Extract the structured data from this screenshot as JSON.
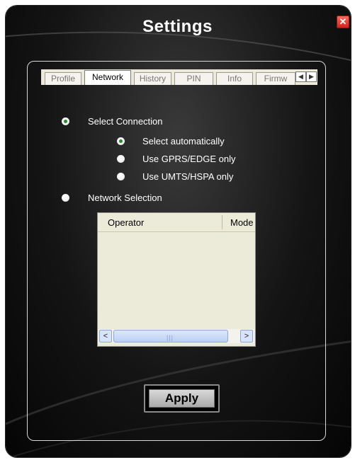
{
  "window": {
    "title": "Settings",
    "close_glyph": "✕"
  },
  "tabs": [
    {
      "label": "Profile",
      "active": false
    },
    {
      "label": "Network",
      "active": true
    },
    {
      "label": "History",
      "active": false
    },
    {
      "label": "PIN",
      "active": false
    },
    {
      "label": "Info",
      "active": false
    },
    {
      "label": "Firmw",
      "active": false
    }
  ],
  "tab_scroll": {
    "left": "◀",
    "right": "▶"
  },
  "connection": {
    "select_connection_label": "Select Connection",
    "select_connection_checked": true,
    "options": [
      {
        "label": "Select automatically",
        "checked": true
      },
      {
        "label": "Use GPRS/EDGE only",
        "checked": false
      },
      {
        "label": "Use UMTS/HSPA only",
        "checked": false
      }
    ],
    "network_selection_label": "Network Selection",
    "network_selection_checked": false
  },
  "operator_list": {
    "columns": [
      "Operator",
      "Mode"
    ],
    "rows": [],
    "scroll_left": "<",
    "scroll_right": ">",
    "scroll_grip": "|||"
  },
  "apply_label": "Apply",
  "colors": {
    "radio_check": "#2a8a2a",
    "close": "#d6201a",
    "list_bg": "#ecead8"
  }
}
